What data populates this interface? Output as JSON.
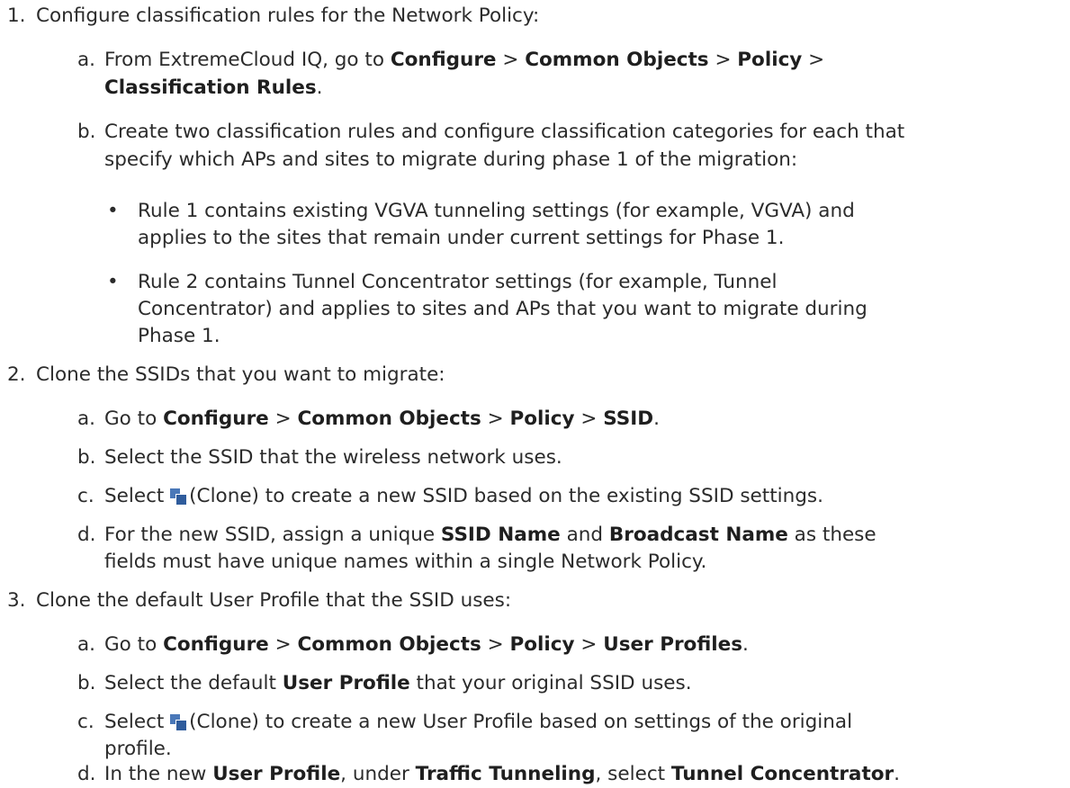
{
  "steps": [
    {
      "number": "1.",
      "text": "Configure classification rules for the Network Policy:",
      "substeps": [
        {
          "letter": "a.",
          "l1_pre": "From ExtremeCloud IQ, go to ",
          "configure": "Configure",
          "sep": ">",
          "common_objects": "Common Objects",
          "policy": "Policy",
          "classification_rules": "Classification Rules",
          "period": "."
        },
        {
          "letter": "b.",
          "line1": "Create two classification rules and configure classification categories for each that",
          "line2": "specify which APs and sites to migrate during phase 1 of the migration:",
          "bullets": [
            {
              "symbol": "•",
              "line1": "Rule 1 contains existing VGVA tunneling settings (for example, VGVA) and",
              "line2": "applies to the sites that remain under current settings for Phase 1."
            },
            {
              "symbol": "•",
              "line1": "Rule 2 contains Tunnel Concentrator settings (for example, Tunnel",
              "line2": "Concentrator) and applies to sites and APs that you want to migrate during",
              "line3": "Phase 1."
            }
          ]
        }
      ]
    },
    {
      "number": "2.",
      "text": "Clone the SSIDs that you want to migrate:",
      "substeps": [
        {
          "letter": "a.",
          "pre": "Go to ",
          "configure": "Configure",
          "sep": ">",
          "common_objects": "Common Objects",
          "policy": "Policy",
          "ssid": "SSID",
          "period": "."
        },
        {
          "letter": "b.",
          "text": "Select the SSID that the wireless network uses."
        },
        {
          "letter": "c.",
          "pre": "Select ",
          "icon": "clone-icon",
          "post": "(Clone) to create a new SSID based on the existing SSID settings."
        },
        {
          "letter": "d.",
          "pre": "For the new SSID, assign a unique ",
          "ssid_name": "SSID Name",
          "and": " and ",
          "broadcast_name": "Broadcast Name",
          "post": " as these",
          "line2": "fields must have unique names within a single Network Policy."
        }
      ]
    },
    {
      "number": "3.",
      "text": "Clone the default User Profile that the SSID uses:",
      "substeps": [
        {
          "letter": "a.",
          "pre": "Go to ",
          "configure": "Configure",
          "sep": ">",
          "common_objects": "Common Objects",
          "policy": "Policy",
          "user_profiles": "User Profiles",
          "period": "."
        },
        {
          "letter": "b.",
          "pre": "Select the default ",
          "user_profile": "User Profile",
          "post": " that your original SSID uses."
        },
        {
          "letter": "c.",
          "pre": "Select ",
          "icon": "clone-icon",
          "post": "(Clone) to create a new User Profile based on settings of the original",
          "line2": "profile."
        },
        {
          "letter": "d.",
          "pre": "In the new ",
          "user_profile": "User Profile",
          "mid1": ", under ",
          "traffic_tunneling": "Traffic Tunneling",
          "mid2": ", select ",
          "tunnel_concentrator": "Tunnel Concentrator",
          "period": "."
        }
      ]
    }
  ]
}
